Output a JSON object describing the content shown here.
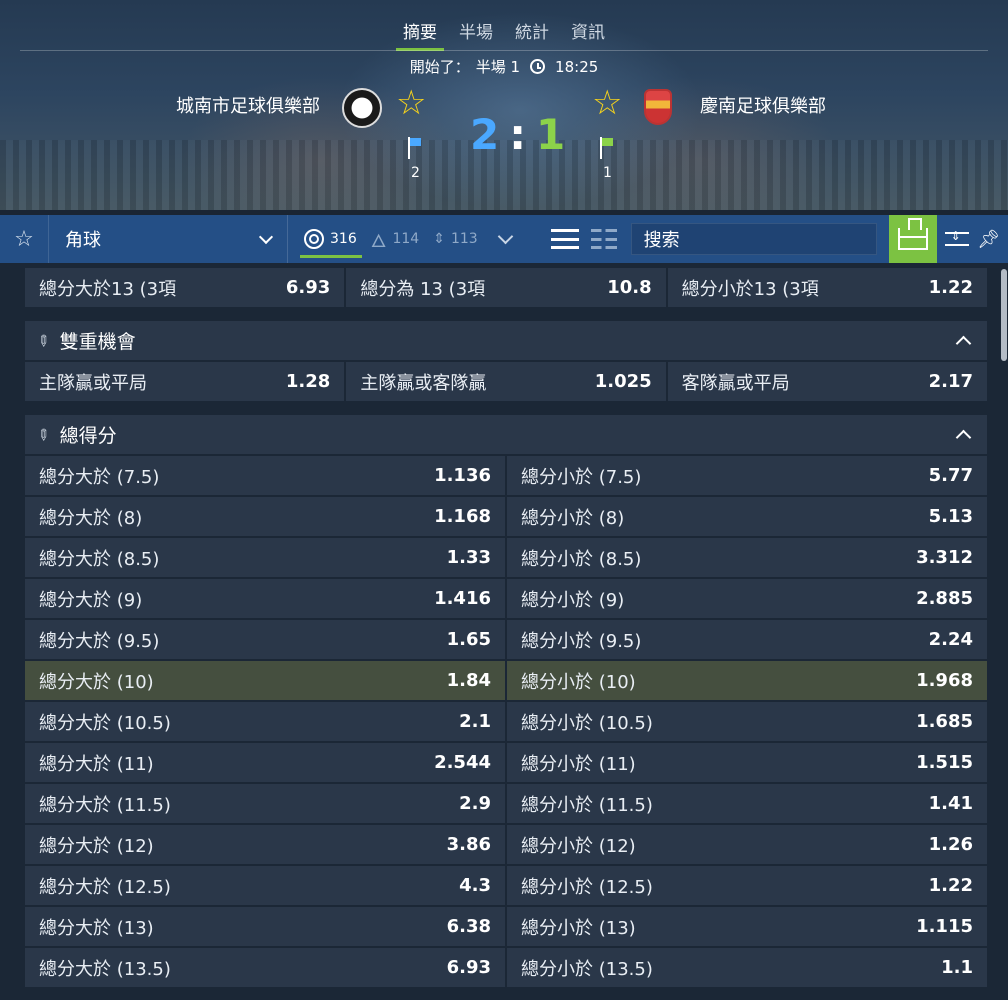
{
  "tabs": [
    "摘要",
    "半場",
    "統計",
    "資訊"
  ],
  "status": {
    "label": "開始了：",
    "period": "半場 1",
    "time": "18:25"
  },
  "match": {
    "home_team": "城南市足球俱樂部",
    "away_team": "慶南足球俱樂部",
    "home_score": "2",
    "score_sep": ":",
    "away_score": "1",
    "home_corners": "2",
    "away_corners": "1"
  },
  "toolbar": {
    "market_select": "角球",
    "filter_all_count": "316",
    "filter_hot_count": "114",
    "filter_move_count": "113",
    "search_label": "搜索"
  },
  "icons": {
    "star": "star-icon",
    "target": "target-icon",
    "fire": "fire-icon",
    "updown": "updown-icon",
    "list": "list-view-icon",
    "grid": "grid-view-icon",
    "field": "field-icon",
    "pin": "pin-icon"
  },
  "colors": {
    "accent_green": "#7cc242",
    "home_blue": "#4aa8ff",
    "away_green": "#8cd34a",
    "toolbar_blue": "#244f86",
    "highlight_row": "#454f3f"
  },
  "top_row": [
    {
      "label": "總分大於13 (3項",
      "odd": "6.93"
    },
    {
      "label": "總分為 13 (3項",
      "odd": "10.8"
    },
    {
      "label": "總分小於13 (3項",
      "odd": "1.22"
    }
  ],
  "double_chance": {
    "title": "雙重機會",
    "items": [
      {
        "label": "主隊贏或平局",
        "odd": "1.28"
      },
      {
        "label": "主隊贏或客隊贏",
        "odd": "1.025"
      },
      {
        "label": "客隊贏或平局",
        "odd": "2.17"
      }
    ]
  },
  "total": {
    "title": "總得分",
    "rows": [
      {
        "over": "總分大於 (7.5)",
        "over_odd": "1.136",
        "under": "總分小於 (7.5)",
        "under_odd": "5.77"
      },
      {
        "over": "總分大於 (8)",
        "over_odd": "1.168",
        "under": "總分小於 (8)",
        "under_odd": "5.13"
      },
      {
        "over": "總分大於 (8.5)",
        "over_odd": "1.33",
        "under": "總分小於 (8.5)",
        "under_odd": "3.312"
      },
      {
        "over": "總分大於 (9)",
        "over_odd": "1.416",
        "under": "總分小於 (9)",
        "under_odd": "2.885"
      },
      {
        "over": "總分大於 (9.5)",
        "over_odd": "1.65",
        "under": "總分小於 (9.5)",
        "under_odd": "2.24"
      },
      {
        "over": "總分大於 (10)",
        "over_odd": "1.84",
        "under": "總分小於 (10)",
        "under_odd": "1.968",
        "highlight": true
      },
      {
        "over": "總分大於 (10.5)",
        "over_odd": "2.1",
        "under": "總分小於 (10.5)",
        "under_odd": "1.685"
      },
      {
        "over": "總分大於 (11)",
        "over_odd": "2.544",
        "under": "總分小於 (11)",
        "under_odd": "1.515"
      },
      {
        "over": "總分大於 (11.5)",
        "over_odd": "2.9",
        "under": "總分小於 (11.5)",
        "under_odd": "1.41"
      },
      {
        "over": "總分大於 (12)",
        "over_odd": "3.86",
        "under": "總分小於 (12)",
        "under_odd": "1.26"
      },
      {
        "over": "總分大於 (12.5)",
        "over_odd": "4.3",
        "under": "總分小於 (12.5)",
        "under_odd": "1.22"
      },
      {
        "over": "總分大於 (13)",
        "over_odd": "6.38",
        "under": "總分小於 (13)",
        "under_odd": "1.115"
      },
      {
        "over": "總分大於 (13.5)",
        "over_odd": "6.93",
        "under": "總分小於 (13.5)",
        "under_odd": "1.1"
      }
    ]
  }
}
